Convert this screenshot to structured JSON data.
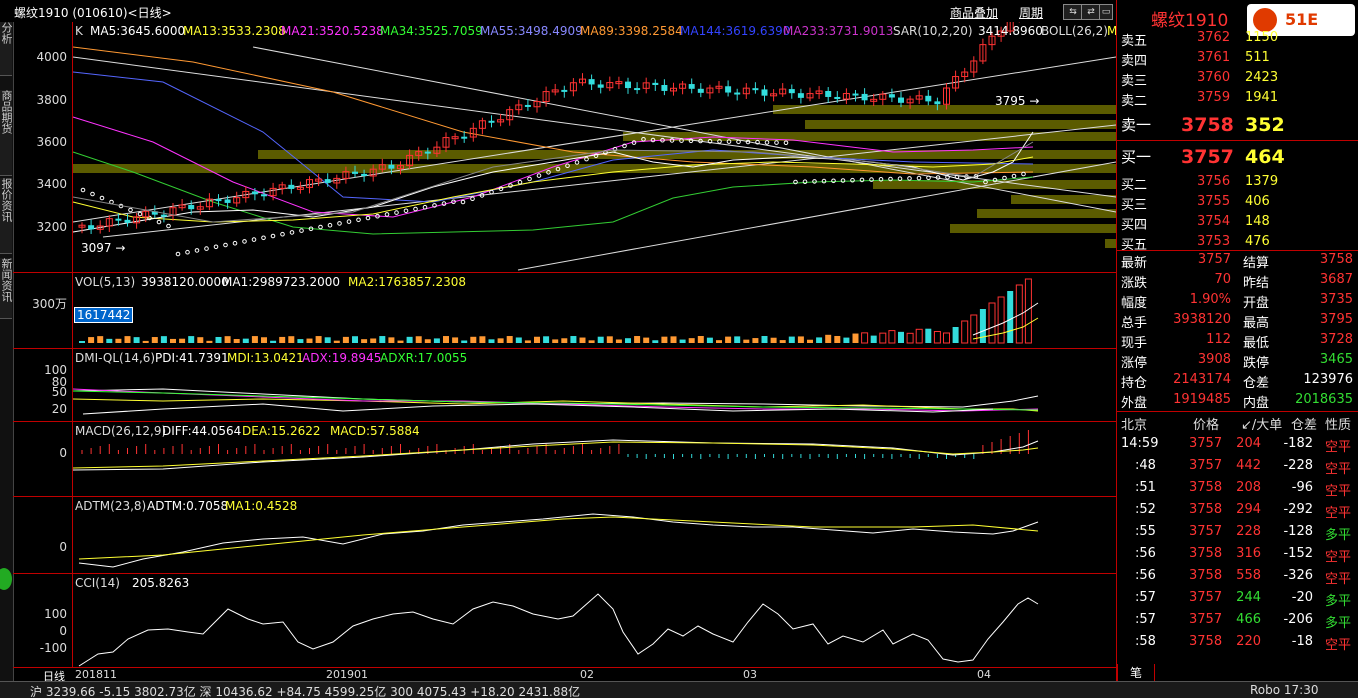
{
  "title": {
    "symbol_line": "螺纹1910 (010610)<日线>",
    "overlay_link": "商品叠加",
    "period_link": "周期",
    "nav_buttons": [
      "⇆",
      "⇄",
      "▭"
    ]
  },
  "left_tabs": [
    "技术分析",
    "商品期货",
    "报价资讯",
    "新闻资讯"
  ],
  "main_chart": {
    "label_k": "K",
    "ma5": "MA5:3645.6000",
    "ma13": "MA13:3533.2308",
    "ma21": "MA21:3520.5238",
    "ma34": "MA34:3525.7059",
    "ma55": "MA55:3498.4909",
    "ma89": "MA89:3398.2584",
    "ma144": "MA144:3619.6390",
    "ma233": "MA233:3731.9013",
    "sar": "SAR(10,2,20)",
    "sar_val": "3414.8960",
    "boll": "BOLL(26,2)",
    "boll_m": "M",
    "y_ticks": [
      "4000",
      "3800",
      "3600",
      "3400",
      "3200"
    ],
    "high_marker": "3795 →",
    "low_marker": "3097 →"
  },
  "vol_chart": {
    "label": "VOL(5,13)",
    "vol": "3938120.0000",
    "ma1": "MA1:2989723.2000",
    "ma2": "MA2:1763857.2308",
    "y_tick": "300万",
    "cursor_value": "1617442"
  },
  "dmi_chart": {
    "label": "DMI-QL(14,6)",
    "pdi": "PDI:41.7391",
    "mdi": "MDI:13.0421",
    "adx": "ADX:19.8945",
    "adxr": "ADXR:17.0055",
    "y_ticks": [
      "100",
      "80",
      "50",
      "20"
    ]
  },
  "macd_chart": {
    "label": "MACD(26,12,9)",
    "diff": "DIFF:44.0564",
    "dea": "DEA:15.2622",
    "macd": "MACD:57.5884",
    "y_tick": "0"
  },
  "adtm_chart": {
    "label": "ADTM(23,8)",
    "adtm": "ADTM:0.7058",
    "ma1": "MA1:0.4528",
    "y_tick": "0"
  },
  "cci_chart": {
    "label": "CCI(14)",
    "value": "205.8263",
    "y_ticks": [
      "100",
      "0",
      "-100"
    ]
  },
  "x_axis": {
    "period_label": "日线",
    "labels": [
      "201811",
      "201901",
      "02",
      "03",
      "04"
    ]
  },
  "quote_panel": {
    "name": "螺纹1910",
    "logo_text": "51E",
    "asks": [
      {
        "label": "卖五",
        "price": "3762",
        "vol": "1150"
      },
      {
        "label": "卖四",
        "price": "3761",
        "vol": "511"
      },
      {
        "label": "卖三",
        "price": "3760",
        "vol": "2423"
      },
      {
        "label": "卖二",
        "price": "3759",
        "vol": "1941"
      },
      {
        "label": "卖一",
        "price": "3758",
        "vol": "352"
      }
    ],
    "bids": [
      {
        "label": "买一",
        "price": "3757",
        "vol": "464"
      },
      {
        "label": "买二",
        "price": "3756",
        "vol": "1379"
      },
      {
        "label": "买三",
        "price": "3755",
        "vol": "406"
      },
      {
        "label": "买四",
        "price": "3754",
        "vol": "148"
      },
      {
        "label": "买五",
        "price": "3753",
        "vol": "476"
      }
    ],
    "stats": [
      {
        "l1": "最新",
        "v1": "3757",
        "l2": "结算",
        "v2": "3758"
      },
      {
        "l1": "涨跌",
        "v1": "70",
        "l2": "昨结",
        "v2": "3687"
      },
      {
        "l1": "幅度",
        "v1": "1.90%",
        "l2": "开盘",
        "v2": "3735"
      },
      {
        "l1": "总手",
        "v1": "3938120",
        "l2": "最高",
        "v2": "3795"
      },
      {
        "l1": "现手",
        "v1": "112",
        "l2": "最低",
        "v2": "3728"
      },
      {
        "l1": "涨停",
        "v1": "3908",
        "l2": "跌停",
        "v2": "3465"
      },
      {
        "l1": "持仓",
        "v1": "2143174",
        "l2": "仓差",
        "v2": "123976"
      },
      {
        "l1": "外盘",
        "v1": "1919485",
        "l2": "内盘",
        "v2": "2018635"
      }
    ],
    "tick_header": {
      "loc": "北京",
      "price": "价格",
      "vol": "↙/大单",
      "oi": "仓差",
      "nature": "性质"
    },
    "ticks": [
      {
        "time": "14:59",
        "price": "3757",
        "vol": "204",
        "oi": "-182",
        "nature": "空平"
      },
      {
        "time": ":48",
        "price": "3757",
        "vol": "442",
        "oi": "-228",
        "nature": "空平"
      },
      {
        "time": ":51",
        "price": "3758",
        "vol": "208",
        "oi": "-96",
        "nature": "空平"
      },
      {
        "time": ":52",
        "price": "3758",
        "vol": "294",
        "oi": "-292",
        "nature": "空平"
      },
      {
        "time": ":55",
        "price": "3757",
        "vol": "228",
        "oi": "-128",
        "nature": "多平"
      },
      {
        "time": ":56",
        "price": "3758",
        "vol": "316",
        "oi": "-152",
        "nature": "空平"
      },
      {
        "time": ":56",
        "price": "3758",
        "vol": "558",
        "oi": "-326",
        "nature": "空平"
      },
      {
        "time": ":57",
        "price": "3757",
        "vol": "244",
        "oi": "-20",
        "nature": "多平"
      },
      {
        "time": ":57",
        "price": "3757",
        "vol": "466",
        "oi": "-206",
        "nature": "多平"
      },
      {
        "time": ":58",
        "price": "3758",
        "vol": "220",
        "oi": "-18",
        "nature": "空平"
      }
    ],
    "footer_tab": "笔"
  },
  "status_bar": {
    "text": "沪 3239.66  -5.15  3802.73亿  深 10436.62  +84.75  4599.25亿  300 4075.43  +18.20  2431.88亿",
    "right_text": "Robo  17:30"
  }
}
